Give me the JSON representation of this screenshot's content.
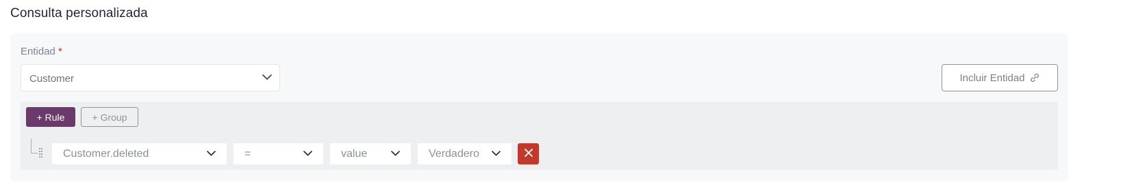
{
  "page": {
    "title": "Consulta personalizada"
  },
  "entity": {
    "label": "Entidad",
    "required_mark": "*",
    "selected": "Customer"
  },
  "include_button": {
    "label": "Incluir Entidad",
    "icon": "link-icon"
  },
  "query_builder": {
    "add_rule_label": "+ Rule",
    "add_group_label": "+ Group",
    "rules": [
      {
        "field": "Customer.deleted",
        "operator": "=",
        "value_type": "value",
        "value": "Verdadero"
      }
    ]
  },
  "colors": {
    "accent": "#6b3a6b",
    "danger": "#c0392b",
    "card_bg": "#f7f8fa",
    "builder_bg": "#eeeff1"
  }
}
